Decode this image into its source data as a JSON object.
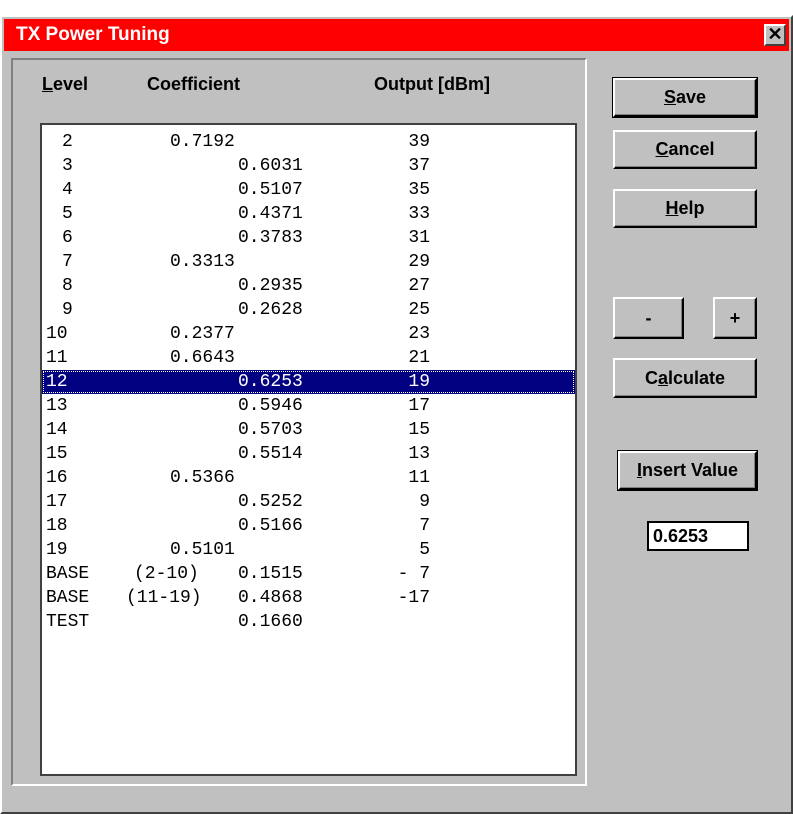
{
  "window": {
    "title": "TX Power Tuning",
    "close_glyph": "✕"
  },
  "columns": {
    "level": {
      "first": "L",
      "rest": "evel"
    },
    "coefficient": "Coefficient",
    "output": "Output [dBm]"
  },
  "rows": [
    {
      "level": "2",
      "coefficient": "0.7192",
      "output": "39",
      "indent": 0
    },
    {
      "level": "3",
      "coefficient": "0.6031",
      "output": "37",
      "indent": 1
    },
    {
      "level": "4",
      "coefficient": "0.5107",
      "output": "35",
      "indent": 1
    },
    {
      "level": "5",
      "coefficient": "0.4371",
      "output": "33",
      "indent": 1
    },
    {
      "level": "6",
      "coefficient": "0.3783",
      "output": "31",
      "indent": 1
    },
    {
      "level": "7",
      "coefficient": "0.3313",
      "output": "29",
      "indent": 0
    },
    {
      "level": "8",
      "coefficient": "0.2935",
      "output": "27",
      "indent": 1
    },
    {
      "level": "9",
      "coefficient": "0.2628",
      "output": "25",
      "indent": 1
    },
    {
      "level": "10",
      "coefficient": "0.2377",
      "output": "23",
      "indent": 0
    },
    {
      "level": "11",
      "coefficient": "0.6643",
      "output": "21",
      "indent": 0
    },
    {
      "level": "12",
      "coefficient": "0.6253",
      "output": "19",
      "indent": 1,
      "selected": true
    },
    {
      "level": "13",
      "coefficient": "0.5946",
      "output": "17",
      "indent": 1
    },
    {
      "level": "14",
      "coefficient": "0.5703",
      "output": "15",
      "indent": 1
    },
    {
      "level": "15",
      "coefficient": "0.5514",
      "output": "13",
      "indent": 1
    },
    {
      "level": "16",
      "coefficient": "0.5366",
      "output": "11",
      "indent": 0
    },
    {
      "level": "17",
      "coefficient": "0.5252",
      "output": "9",
      "indent": 1
    },
    {
      "level": "18",
      "coefficient": "0.5166",
      "output": "7",
      "indent": 1
    },
    {
      "level": "19",
      "coefficient": "0.5101",
      "output": "5",
      "indent": 0
    },
    {
      "level": "BASE",
      "range": "(2-10)",
      "coefficient": "0.1515",
      "output": "- 7",
      "indent": 1
    },
    {
      "level": "BASE",
      "range": "(11-19)",
      "coefficient": "0.4868",
      "output": "-17",
      "indent": 1
    },
    {
      "level": "TEST",
      "coefficient": "0.1660",
      "output": "",
      "indent": 1
    }
  ],
  "buttons": {
    "save": {
      "mnemonic": "S",
      "rest": "ave"
    },
    "cancel": {
      "mnemonic": "C",
      "rest": "ancel"
    },
    "help": {
      "mnemonic": "H",
      "rest": "elp"
    },
    "minus": "-",
    "plus": "+",
    "calculate": {
      "before": "C",
      "mnemonic": "a",
      "rest": "lculate"
    },
    "insert_value": {
      "mnemonic": "I",
      "rest": "nsert Value"
    }
  },
  "value_field": "0.6253",
  "colors": {
    "titlebar": "#ff0000",
    "selection": "#000080",
    "face": "#c0c0c0"
  }
}
